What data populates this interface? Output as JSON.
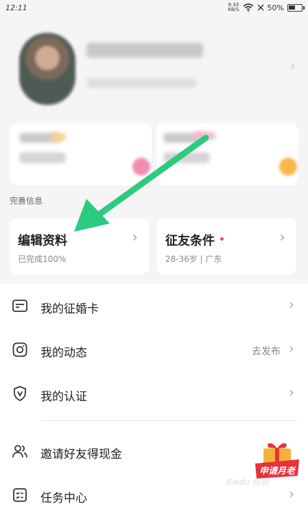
{
  "status_bar": {
    "time": "12:11",
    "net_speed_value": "8.33",
    "net_speed_unit": "KB/S",
    "battery": "50%"
  },
  "section": {
    "title": "完善信息"
  },
  "cards": [
    {
      "title": "编辑资料",
      "subtitle": "已完成100%"
    },
    {
      "title": "征友条件",
      "subtitle": "28-36岁 | 广东"
    }
  ],
  "list": [
    {
      "label": "我的征婚卡",
      "icon": "id-card-icon"
    },
    {
      "label": "我的动态",
      "extra": "去发布",
      "icon": "instagram-icon"
    },
    {
      "label": "我的认证",
      "icon": "shield-v-icon"
    },
    {
      "label": "邀请好友得现金",
      "icon": "users-icon"
    },
    {
      "label": "任务中心",
      "icon": "task-list-icon"
    }
  ],
  "promo": {
    "text": "申请月老"
  },
  "watermark": {
    "text": "Baidu 经验"
  },
  "colors": {
    "arrow": "#2ccb7f",
    "red_dot": "#f24a5c",
    "promo_red": "#e8323c"
  }
}
